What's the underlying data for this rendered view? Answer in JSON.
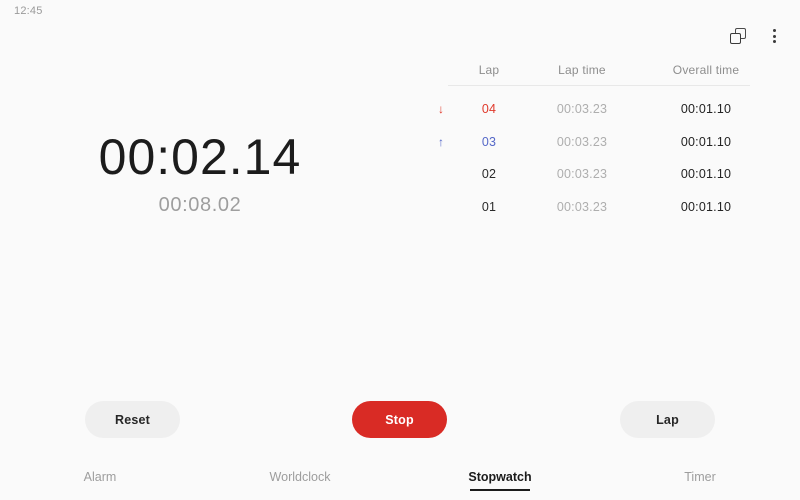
{
  "status_bar": {
    "clock": "12:45"
  },
  "top_actions": {
    "multiwindow_icon": "copy-icon",
    "overflow_icon": "more-vertical-icon"
  },
  "timer": {
    "main_time": "00:02.14",
    "sub_time": "00:08.02"
  },
  "lap_table": {
    "headers": {
      "lap": "Lap",
      "lap_time": "Lap time",
      "overall_time": "Overall time"
    },
    "rows": [
      {
        "marker": "↓",
        "marker_name": "arrow-down-icon",
        "marker_color": "#e0392b",
        "lap": "04",
        "lap_color": "#e0392b",
        "lap_time": "00:03.23",
        "overall_time": "00:01.10"
      },
      {
        "marker": "↑",
        "marker_name": "arrow-up-icon",
        "marker_color": "#5568c8",
        "lap": "03",
        "lap_color": "#5568c8",
        "lap_time": "00:03.23",
        "overall_time": "00:01.10"
      },
      {
        "marker": "",
        "marker_name": "",
        "marker_color": "",
        "lap": "02",
        "lap_color": "#2a2a2a",
        "lap_time": "00:03.23",
        "overall_time": "00:01.10"
      },
      {
        "marker": "",
        "marker_name": "",
        "marker_color": "",
        "lap": "01",
        "lap_color": "#2a2a2a",
        "lap_time": "00:03.23",
        "overall_time": "00:01.10"
      }
    ]
  },
  "controls": {
    "reset_label": "Reset",
    "stop_label": "Stop",
    "lap_label": "Lap"
  },
  "tabs": [
    {
      "label": "Alarm",
      "active": false
    },
    {
      "label": "Worldclock",
      "active": false
    },
    {
      "label": "Stopwatch",
      "active": true
    },
    {
      "label": "Timer",
      "active": false
    }
  ],
  "colors": {
    "background": "#fafafa",
    "accent_red": "#d92b25",
    "lap_red": "#e0392b",
    "lap_blue": "#5568c8",
    "button_grey": "#efefef",
    "muted_text": "#9e9e9e"
  }
}
